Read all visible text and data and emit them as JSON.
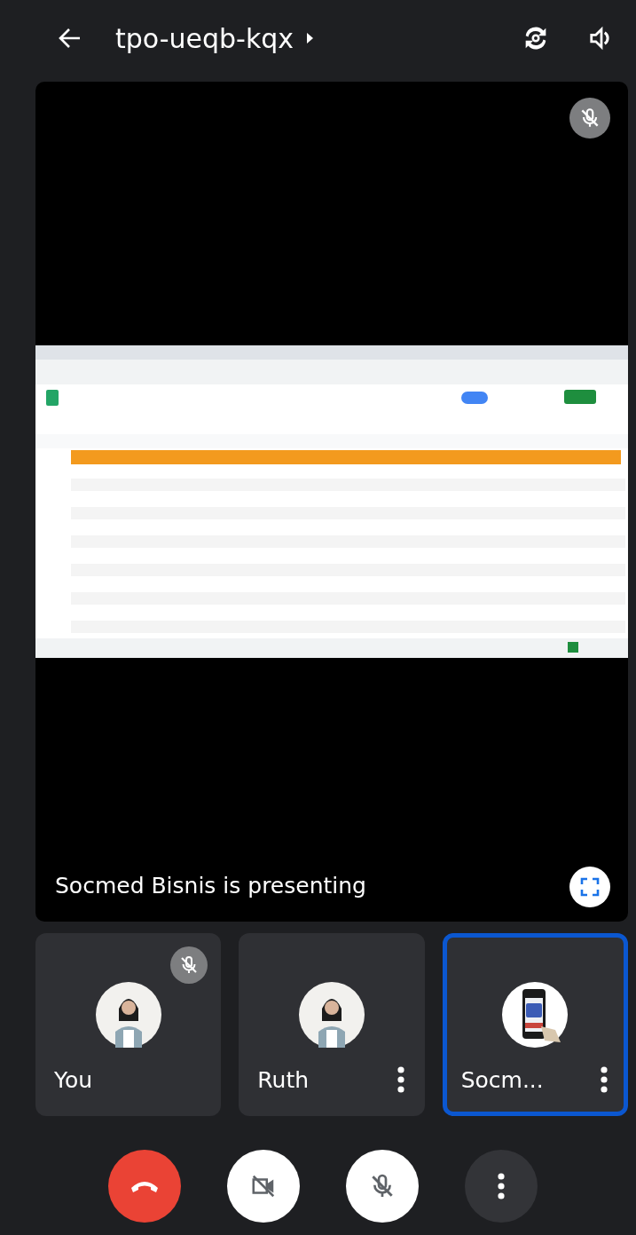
{
  "header": {
    "meeting_code": "tpo-ueqb-kqx"
  },
  "stage": {
    "muted": true,
    "caption": "Socmed Bisnis is presenting"
  },
  "participants": [
    {
      "name": "You",
      "muted": true,
      "menu": false,
      "highlighted": false,
      "avatar": {
        "kind": "person"
      }
    },
    {
      "name": "Ruth",
      "muted": false,
      "menu": true,
      "highlighted": false,
      "avatar": {
        "kind": "person"
      }
    },
    {
      "name": "Socm...",
      "muted": false,
      "menu": true,
      "highlighted": true,
      "avatar": {
        "kind": "phone"
      }
    }
  ],
  "controls": {
    "camera_on": false,
    "mic_on": false
  }
}
